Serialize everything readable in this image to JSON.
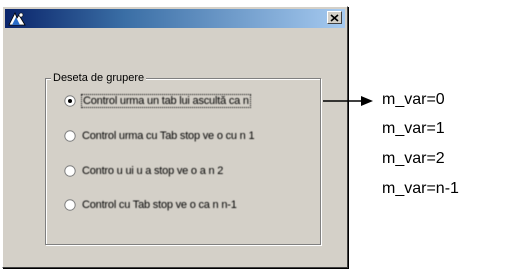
{
  "dialog": {
    "close_symbol": "×",
    "icon": "app-icon"
  },
  "group": {
    "legend": "Deseta de grupere",
    "options": [
      {
        "label": "Control urma un tab  lui ascultă  ca  n",
        "selected": true
      },
      {
        "label": "Control urma  cu  Tab stop ve o cu n 1",
        "selected": false
      },
      {
        "label": "Contro  u  ui u  a stop  ve  o  a  n 2",
        "selected": false
      },
      {
        "label": "Control cu Tab stop ve o ca  n n-1",
        "selected": false
      }
    ]
  },
  "annotations": {
    "vars": [
      "m_var=0",
      "m_var=1",
      "m_var=2",
      "m_var=n-1"
    ]
  },
  "colors": {
    "dialog_face": "#d4d0c8",
    "title_start": "#0a246a",
    "title_end": "#a6caf0"
  }
}
